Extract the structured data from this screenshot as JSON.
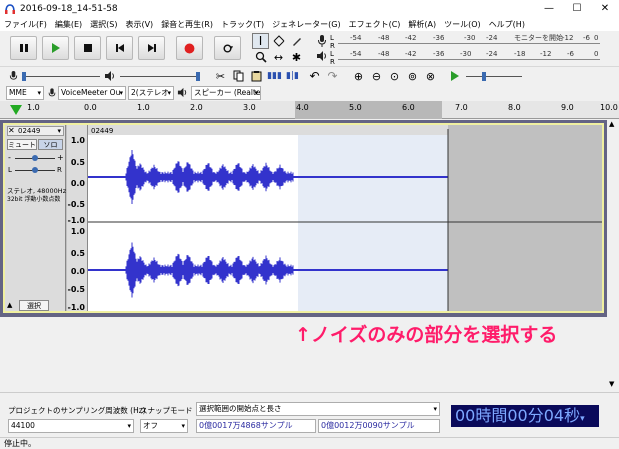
{
  "window": {
    "title": "2016-09-18_14-51-58"
  },
  "menu": [
    "ファイル(F)",
    "編集(E)",
    "選択(S)",
    "表示(V)",
    "録音と再生(R)",
    "トラック(T)",
    "ジェネレーター(G)",
    "エフェクト(C)",
    "解析(A)",
    "ツール(O)",
    "ヘルプ(H)"
  ],
  "meters": {
    "scale": [
      "-54",
      "-48",
      "-42",
      "-36",
      "-30",
      "-24",
      "-18",
      "-12",
      "-6",
      "0"
    ],
    "monitor_label": "モニターを開始"
  },
  "devices": {
    "host": "MME",
    "input": "VoiceMeeter Ou",
    "channels": "2(ステレオ",
    "output": "スピーカー (Realte"
  },
  "ruler": {
    "labels": [
      "1.0",
      "0.0",
      "1.0",
      "2.0",
      "3.0",
      "4.0",
      "5.0",
      "6.0",
      "7.0",
      "8.0",
      "9.0",
      "10.0"
    ]
  },
  "track": {
    "name": "02449",
    "clip_name": "02449",
    "mute": "ミュート",
    "solo": "ソロ",
    "gain_minus": "-",
    "gain_plus": "+",
    "pan_l": "L",
    "pan_r": "R",
    "format": "ステレオ, 48000Hz",
    "bitdepth": "32bit 浮動小数点数",
    "select": "選択",
    "scale": [
      "1.0",
      "0.5",
      "0.0",
      "-0.5",
      "-1.0",
      "1.0",
      "0.5",
      "0.0",
      "-0.5",
      "-1.0"
    ]
  },
  "annotation": "↑ノイズのみの部分を選択する",
  "bottom": {
    "rate_label": "プロジェクトのサンプリング周波数 (Hz)",
    "rate_value": "44100",
    "snap_label": "スナップモード",
    "snap_value": "オフ",
    "sel_label": "選択範囲の開始点と長さ",
    "sel_start": "0億0017万4868サンプル",
    "sel_length": "0億0012万0090サンプル",
    "time": "00時間00分04秒"
  },
  "status": "停止中。",
  "colors": {
    "wave": "#3333cc",
    "selection": "#e6ecf6",
    "annotation": "#ff1c6a",
    "time_bg": "#0a0a5a",
    "time_fg": "#7da8ff"
  }
}
